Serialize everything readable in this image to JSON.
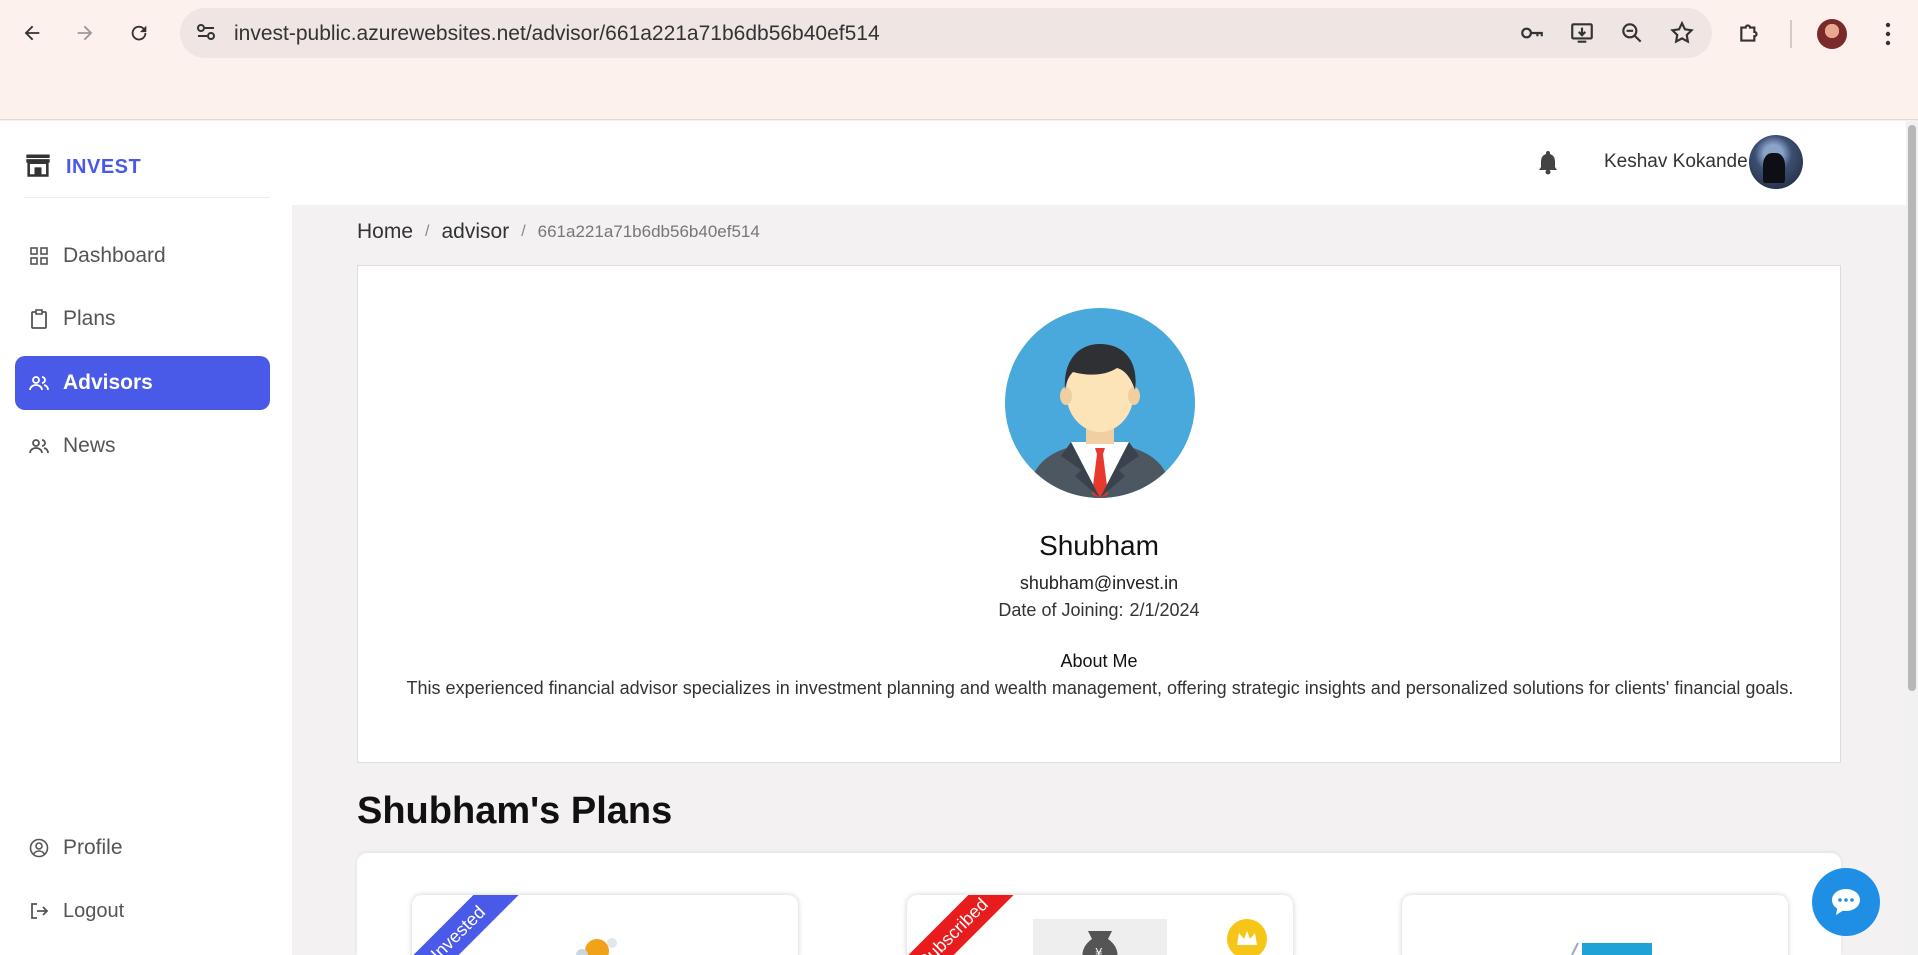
{
  "browser": {
    "url": "invest-public.azurewebsites.net/advisor/661a221a71b6db56b40ef514"
  },
  "sidebar": {
    "brand": "INVEST",
    "items": [
      {
        "label": "Dashboard",
        "icon": "grid-icon"
      },
      {
        "label": "Plans",
        "icon": "clipboard-icon"
      },
      {
        "label": "Advisors",
        "icon": "people-icon",
        "active": true
      },
      {
        "label": "News",
        "icon": "people-icon"
      }
    ],
    "footer": [
      {
        "label": "Profile",
        "icon": "user-circle-icon"
      },
      {
        "label": "Logout",
        "icon": "logout-icon"
      }
    ],
    "accent": "#4a5ae8"
  },
  "header": {
    "user_name": "Keshav Kokande"
  },
  "breadcrumb": {
    "home": "Home",
    "section": "advisor",
    "current": "661a221a71b6db56b40ef514"
  },
  "advisor": {
    "name": "Shubham",
    "email": "shubham@invest.in",
    "joined_label": "Date of Joining:",
    "joined_date": "2/1/2024",
    "about_title": "About Me",
    "about_text": "This experienced financial advisor specializes in investment planning and wealth management, offering strategic insights and personalized solutions for clients' financial goals."
  },
  "plans": {
    "title": "Shubham's Plans",
    "cards": [
      {
        "ribbon": "Invested",
        "ribbon_color": "#4a5ae8"
      },
      {
        "ribbon": "Subscribed",
        "ribbon_color": "#e81c1c"
      },
      {
        "ribbon": ""
      }
    ]
  }
}
